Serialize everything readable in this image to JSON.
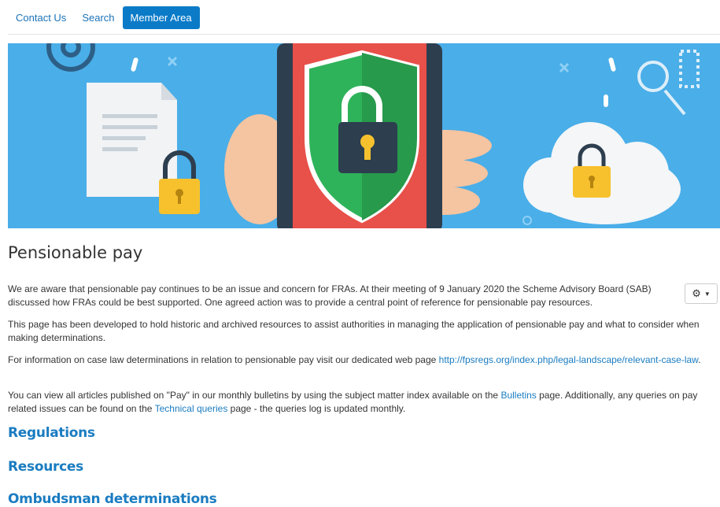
{
  "nav": {
    "items": [
      {
        "label": "Contact Us"
      },
      {
        "label": "Search"
      },
      {
        "label": "Member Area"
      }
    ]
  },
  "page": {
    "title": "Pensionable pay"
  },
  "paragraphs": {
    "p1": "We are aware that pensionable pay continues to be an issue and concern for FRAs. At their meeting of 9 January 2020 the Scheme Advisory Board (SAB) discussed how FRAs could be best supported. One agreed action was to provide a central point of reference for pensionable pay resources.",
    "p2": "This page has been developed to hold historic and archived resources to assist authorities in managing the application of pensionable pay and what to consider when making determinations.",
    "p3_text": "For information on case law determinations in relation to pensionable pay visit our dedicated web page ",
    "p3_link": "http://fpsregs.org/index.php/legal-landscape/relevant-case-law",
    "p3_end": ".",
    "p4_a": "You can view all articles published on \"Pay\" in our monthly bulletins by using the subject matter index available on the ",
    "p4_link1": "Bulletins",
    "p4_b": " page. Additionally, any queries on pay related issues can be found on the ",
    "p4_link2": "Technical queries",
    "p4_c": " page - the queries log is updated monthly."
  },
  "sections": [
    {
      "label": "Regulations"
    },
    {
      "label": "Resources"
    },
    {
      "label": "Ombudsman determinations"
    }
  ],
  "icons": {
    "settings": "gear-icon",
    "caret": "caret-down-icon"
  },
  "colors": {
    "accent": "#0b7bc8",
    "link": "#1a7cc1",
    "hero_bg": "#4aaee8",
    "shield_green": "#2fb35a",
    "phone_red": "#e8504a",
    "lock_yellow": "#f7c12e"
  }
}
